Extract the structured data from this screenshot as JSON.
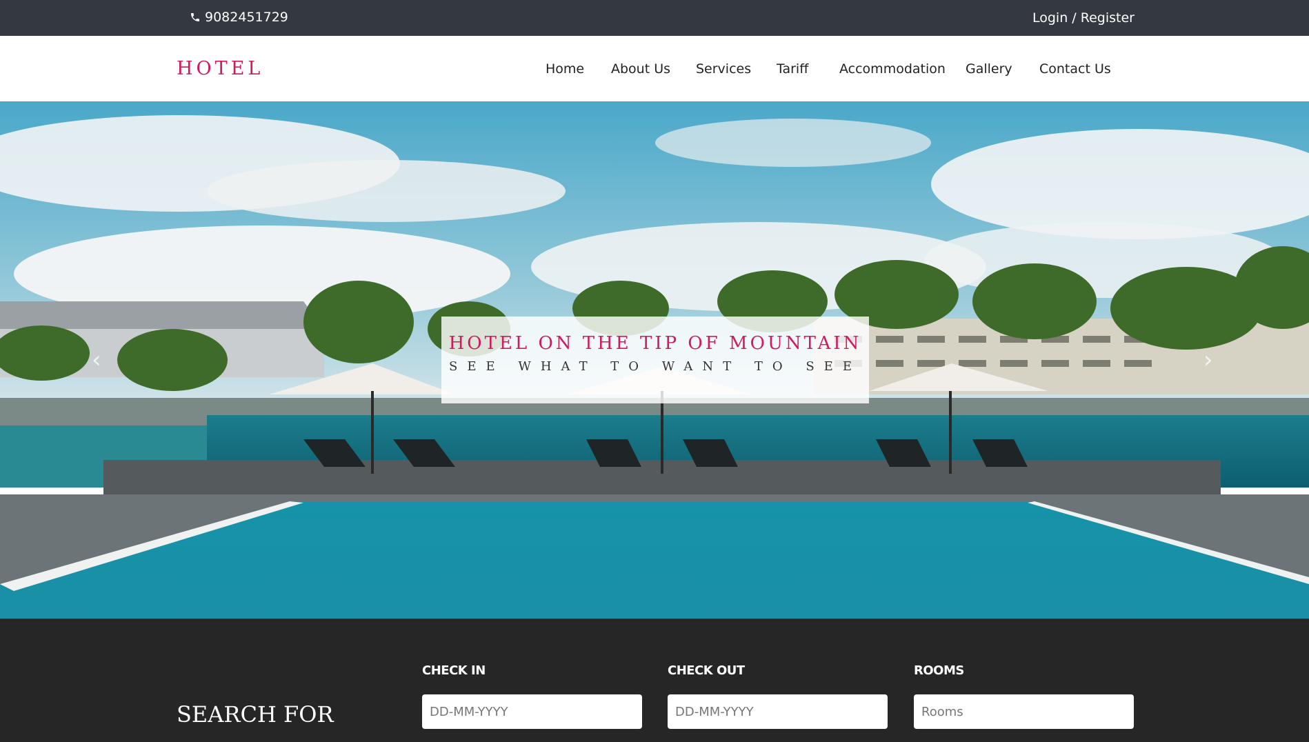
{
  "topbar": {
    "phone": "9082451729",
    "login": "Login / Register"
  },
  "navbar": {
    "logo": "HOTEL",
    "items": [
      "Home",
      "About Us",
      "Services",
      "Tariff",
      "Accommodation",
      "Gallery",
      "Contact Us"
    ]
  },
  "hero": {
    "title": "HOTEL ON THE TIP OF MOUNTAIN",
    "subtitle": "SEE WHAT TO WANT TO SEE",
    "prev_icon": "chevron-left-icon",
    "next_icon": "chevron-right-icon"
  },
  "search": {
    "heading": "SEARCH FOR",
    "checkin_label": "CHECK IN",
    "checkin_placeholder": "DD-MM-YYYY",
    "checkout_label": "CHECK OUT",
    "checkout_placeholder": "DD-MM-YYYY",
    "rooms_label": "ROOMS",
    "rooms_placeholder": "Rooms"
  },
  "colors": {
    "brand": "#d3185f",
    "topbar": "#333841",
    "search_bg": "#262626"
  }
}
